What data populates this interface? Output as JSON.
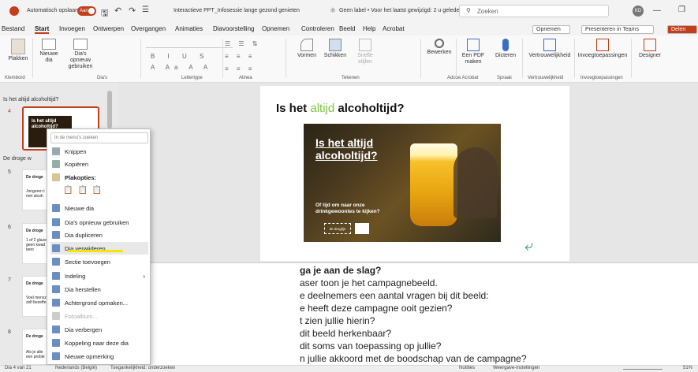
{
  "titlebar": {
    "autosave": "Automatisch opslaan",
    "toggle": "Aan",
    "doc_title": "Interactieve PPT_Infosessie lange gezond genieten",
    "label_status": "Geen label • Voor het laatst gewijzigd: 2 u geleden",
    "search_placeholder": "Zoeken",
    "avatar_initials": "KD"
  },
  "menubar": {
    "tabs": [
      "Bestand",
      "Start",
      "Invoegen",
      "Ontwerpen",
      "Overgangen",
      "Animaties",
      "Diavoorstelling",
      "Opnemen",
      "Controleren",
      "Beeld",
      "Help",
      "Acrobat"
    ],
    "opnemen_btn": "Opnemen",
    "teams_btn": "Presenteren in Teams",
    "delen_btn": "Delen"
  },
  "ribbon": {
    "plakken": "Plakken",
    "nieuwe_dia": "Nieuwe dia",
    "dia_opnieuw": "Dia's opnieuw gebruiken",
    "vormen": "Vormen",
    "schikken": "Schikken",
    "snelle_stijlen": "Snelle stijlen",
    "bewerken": "Bewerken",
    "een_pdf": "Een PDF maken",
    "dicteren": "Dicteren",
    "vertrouwelijkheid": "Vertrouwelijkheid",
    "invoegtoepassingen": "Invoegtoepassingen",
    "designer": "Designer",
    "groups": [
      "Klembord",
      "Dia's",
      "Lettertype",
      "Alinea",
      "Tekenen",
      "Adobe Acrobat",
      "Spraak",
      "Vertrouwelijkheid",
      "Invoegtoepassingen"
    ]
  },
  "thumbnails": {
    "section1": "Is het altijd alcoholtijd?",
    "section2": "De droge w",
    "slide4_num": "4",
    "slide5_num": "5",
    "slide6_num": "6",
    "slide7_num": "7",
    "slide8_num": "8",
    "slide5_title": "De droge",
    "slide5_text": "Jongeren t met alcoh",
    "slide6_title": "De droge",
    "slide6_text": "1 of 2 glaze geen kwad bent",
    "slide7_title": "De droge",
    "slide7_text": "Voel mensz zelf bezeffe",
    "slide8_title": "De droge",
    "slide8_text": "Als je alle een proble",
    "thumb4_line1": "Is het altijd",
    "thumb4_line2": "alcoholtijd?"
  },
  "slide": {
    "title_pre": "Is het ",
    "title_accent": "altijd",
    "title_post": " alcoholtijd?",
    "img_line1": "Is het altijd",
    "img_line2": "alcoholtijd?",
    "img_sub1": "Of tijd om naar onze",
    "img_sub2": "drinkgewoontes te kijken?",
    "logo_text": "de druglijn",
    "accent_color": "#7fc241"
  },
  "context_menu": {
    "search_placeholder": "In de menu's zoeken",
    "items": [
      "Knippen",
      "Kopiëren",
      "Plakopties:",
      "Nieuwe dia",
      "Dia's opnieuw gebruiken",
      "Dia dupliceren",
      "Dia verwijderen",
      "Sectie toevoegen",
      "Indeling",
      "Dia herstellen",
      "Achtergrond opmaken...",
      "Fotoalbum...",
      "Dia verbergen",
      "Koppeling naar deze dia",
      "Nieuwe opmerking"
    ]
  },
  "notes": {
    "lines": [
      "ga je aan de slag?",
      "aser toon je het campagnebeeld.",
      "e deelnemers een aantal vragen bij dit beeld:",
      "e heeft deze campagne ooit gezien?",
      "t zien jullie hierin?",
      "dit beeld herkenbaar?",
      "dit soms van toepassing op jullie?",
      "n jullie akkoord met de boodschap van de campagne?"
    ]
  },
  "statusbar": {
    "slide_count": "Dia 4 van 21",
    "language": "Nederlands (België)",
    "accessibility": "Toegankelijkheid: onderzoeken",
    "notes_btn": "Notities",
    "display_btn": "Weergave-instellingen",
    "zoom": "51%"
  }
}
